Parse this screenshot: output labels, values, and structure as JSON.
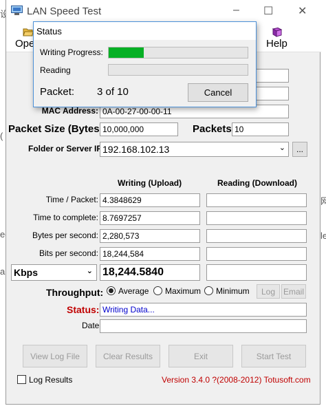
{
  "window": {
    "title": "LAN Speed Test",
    "controls": {
      "minimize": "–",
      "maximize": "☐",
      "close": "✕"
    }
  },
  "menu": {
    "open_label": "Ope",
    "help_label": "Help"
  },
  "main": {
    "mac_label": "MAC Address:",
    "mac_value": "0A-00-27-00-00-11",
    "packet_size_label": "Packet Size (Bytes):",
    "packet_size_value": "10,000,000",
    "packets_label": "Packets:",
    "packets_value": "10",
    "folder_label": "Folder or Server IP:",
    "folder_value": "192.168.102.13",
    "browse_label": "...",
    "col_writing": "Writing (Upload)",
    "col_reading": "Reading (Download)",
    "rows": [
      {
        "label": "Time / Packet:",
        "write": "4.3848629",
        "read": ""
      },
      {
        "label": "Time to complete:",
        "write": "8.7697257",
        "read": ""
      },
      {
        "label": "Bytes per second:",
        "write": "2,280,573",
        "read": ""
      },
      {
        "label": "Bits per second:",
        "write": "18,244,584",
        "read": ""
      }
    ],
    "unit_select": "Kbps",
    "unit_write": "18,244.5840",
    "unit_read": "",
    "throughput_label": "Throughput:",
    "radio_average": "Average",
    "radio_maximum": "Maximum",
    "radio_minimum": "Minimum",
    "log_button": "Log",
    "email_button": "Email",
    "status_label": "Status:",
    "status_value": "Writing Data...",
    "date_label": "Date:",
    "date_value": ""
  },
  "buttons": {
    "view_log": "View Log File",
    "clear": "Clear Results",
    "exit": "Exit",
    "start": "Start Test"
  },
  "footer": {
    "log_results": "Log Results",
    "version": "Version 3.4.0  ?(2008-2012) Totusoft.com"
  },
  "dialog": {
    "title": "Status",
    "writing_label": "Writing Progress:",
    "writing_progress": 0.25,
    "reading_label": "Reading",
    "reading_progress": 0,
    "packet_label": "Packet:",
    "packet_value": "3 of 10",
    "cancel_label": "Cancel"
  },
  "background_edge": {
    "chars": [
      "设",
      "(",
      "eg",
      "a",
      "网",
      "le"
    ]
  },
  "colors": {
    "progress": "#06b025",
    "status_label": "#c00000",
    "status_value": "#0000cc",
    "version": "#c00000",
    "dialog_border": "#4b90d8"
  }
}
